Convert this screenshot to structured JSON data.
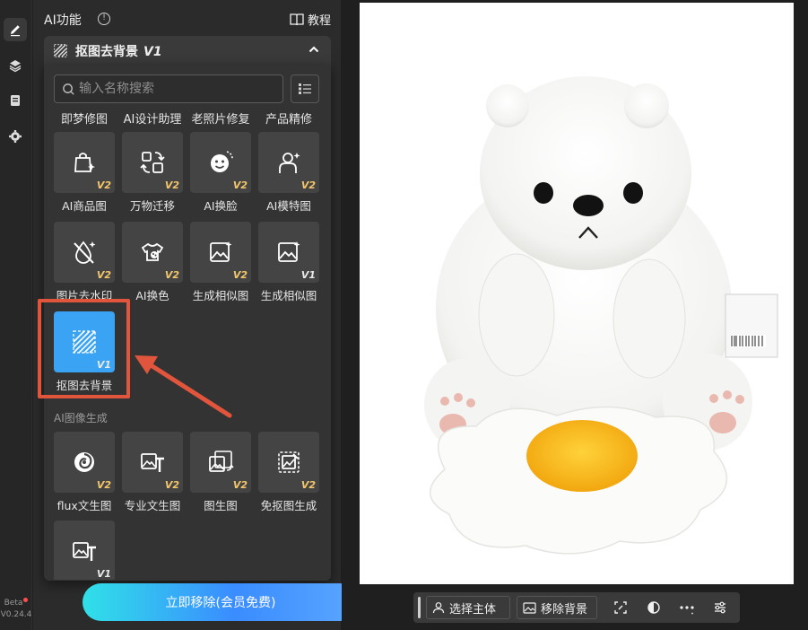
{
  "rail": {
    "version_beta": "Beta",
    "version_number": "V0.24.4"
  },
  "panel": {
    "title": "AI功能",
    "tutorial_label": "教程",
    "feature_select": {
      "label": "抠图去背景",
      "version": "V1"
    },
    "search": {
      "placeholder": "输入名称搜索"
    },
    "cut_row": [
      "即梦修图",
      "AI设计助理",
      "老照片修复",
      "产品精修"
    ],
    "tiles": [
      {
        "name": "AI商品图",
        "version": "V2",
        "icon": "shopping-bag-sparkle-icon"
      },
      {
        "name": "万物迁移",
        "version": "V2",
        "icon": "transfer-image-icon"
      },
      {
        "name": "AI换脸",
        "version": "V2",
        "icon": "face-swap-icon"
      },
      {
        "name": "AI模特图",
        "version": "V2",
        "icon": "model-person-icon"
      },
      {
        "name": "图片去水印",
        "version": "V2",
        "icon": "watermark-remove-icon"
      },
      {
        "name": "AI换色",
        "version": "V2",
        "icon": "shirt-palette-icon"
      },
      {
        "name": "生成相似图",
        "version": "V2",
        "icon": "similar-image-icon"
      },
      {
        "name": "生成相似图",
        "version": "V1",
        "icon": "similar-image-icon"
      },
      {
        "name": "抠图去背景",
        "version": "V1",
        "icon": "stripes-icon",
        "selected": true
      }
    ],
    "section_title": "AI图像生成",
    "gen_tiles": [
      {
        "name": "flux文生图",
        "version": "V2",
        "icon": "flux-swirl-icon"
      },
      {
        "name": "专业文生图",
        "version": "V2",
        "icon": "image-text-icon"
      },
      {
        "name": "图生图",
        "version": "V2",
        "icon": "image-to-image-icon"
      },
      {
        "name": "免抠图生成",
        "version": "V2",
        "icon": "cutout-free-icon"
      },
      {
        "name": "",
        "version": "V1",
        "icon": "image-text-icon"
      }
    ],
    "action_button": "立即移除(会员免费)"
  },
  "toolbar": {
    "select_subject": "选择主体",
    "remove_background": "移除背景"
  },
  "colors": {
    "selected_tile": "#3aa3f4",
    "highlight": "#e0553c",
    "version_gold": "#f3c66b"
  }
}
